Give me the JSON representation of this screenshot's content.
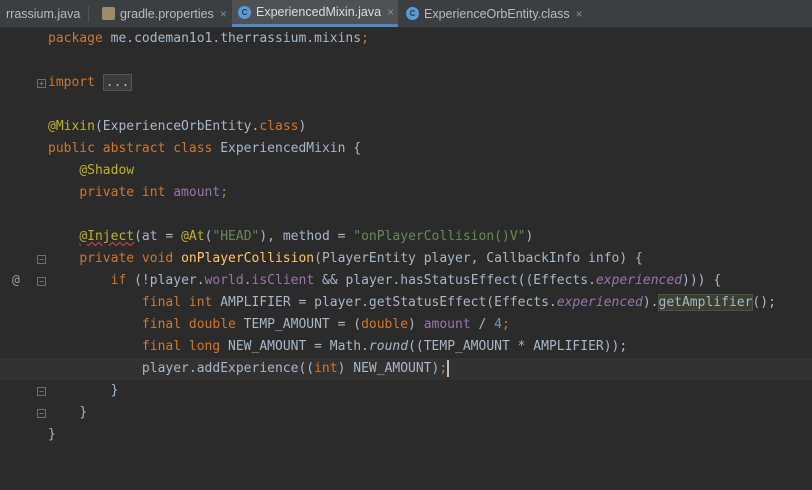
{
  "tabs": [
    {
      "label": "rrassium.java",
      "active": false,
      "icon": "java-file-icon"
    },
    {
      "label": "gradle.properties",
      "active": false,
      "icon": "properties-file-icon"
    },
    {
      "label": "ExperiencedMixin.java",
      "active": true,
      "icon": "class-file-icon"
    },
    {
      "label": "ExperienceOrbEntity.class",
      "active": false,
      "icon": "class-file-icon"
    }
  ],
  "tab_close_glyph": "×",
  "gutter": {
    "at_symbol": "@"
  },
  "code": {
    "package_kw": "package",
    "package_name": " me.codeman1o1.therrassium.mixins",
    "semi": ";",
    "import_kw": "import",
    "import_fold": "...",
    "mixin_ann": "@Mixin",
    "mixin_args": "(ExperienceOrbEntity.",
    "class_kw": "class",
    "rparen": ")",
    "l5_kw": "public abstract class",
    "l5_name": " ExperiencedMixin {",
    "shadow_ann": "@Shadow",
    "l7_kw": "private int",
    "l7_field": "amount",
    "inject_ann": "@Inject",
    "l9_a": "(at = ",
    "at_ann": "@At",
    "l9_b": "(",
    "head_str": "\"HEAD\"",
    "l9_c": "), method = ",
    "method_str": "\"onPlayerCollision()V\"",
    "l9_d": ")",
    "l10_kw": "private void",
    "l10_fn": "onPlayerCollision",
    "l10_rest": "(PlayerEntity player, CallbackInfo info) {",
    "l11_kw": "if",
    "l11_a": " (!player.",
    "world": "world",
    "dot": ".",
    "isClient": "isClient",
    "l11_b": " && player.hasStatusEffect((Effects.",
    "experienced": "experienced",
    "l11_c": "))) {",
    "l12_kw": "final int",
    "l12_a": " AMPLIFIER = player.getStatusEffect(Effects.",
    "l12_b": ").",
    "getAmplifier": "getAmplifier",
    "l12_c": "();",
    "l13_kw": "final double",
    "l13_a": " TEMP_AMOUNT = (",
    "double_kw": "double",
    "l13_b": ") ",
    "amount": "amount",
    "l13_c": " / ",
    "four": "4",
    "l14_kw": "final long",
    "l14_a": " NEW_AMOUNT = Math.",
    "round": "round",
    "l14_b": "((TEMP_AMOUNT * AMPLIFIER));",
    "l15_a": "player.addExperience((",
    "int_kw": "int",
    "l15_b": ") NEW_AMOUNT)",
    "rbrace": "}"
  }
}
